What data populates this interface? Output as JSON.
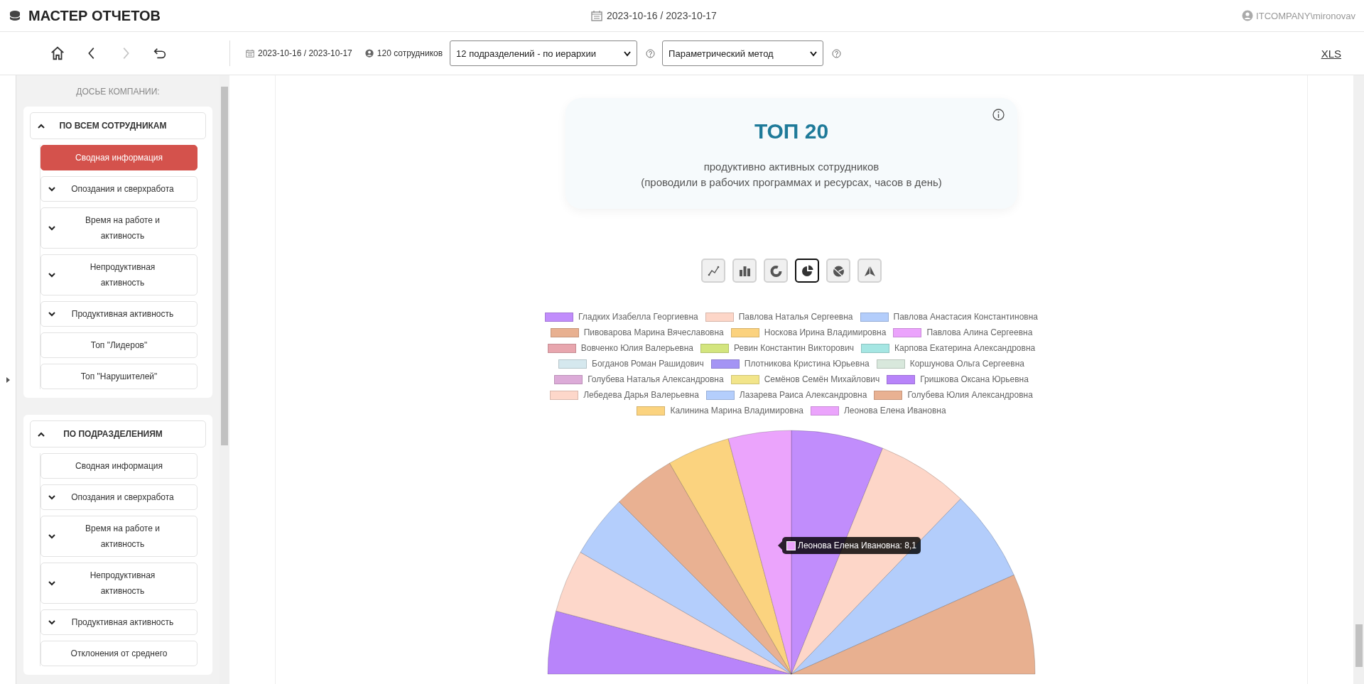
{
  "header": {
    "title": "МАСТЕР ОТЧЕТОВ",
    "period": "2023-10-16 / 2023-10-17",
    "user": "ITCOMPANY\\mironovav"
  },
  "toolbar": {
    "nav": [
      {
        "kind": "home",
        "disabled": false
      },
      {
        "kind": "back",
        "disabled": false
      },
      {
        "kind": "forward",
        "disabled": true
      },
      {
        "kind": "undo",
        "disabled": false
      }
    ],
    "period": "2023-10-16 / 2023-10-17",
    "employees": "120 сотрудников",
    "division_select": {
      "value": "12 подразделений - по иерархии"
    },
    "method_select": {
      "value": "Параметрический метод"
    },
    "export_link": "XLS"
  },
  "sidebar": {
    "title": "ДОСЬЕ КОМПАНИИ:",
    "sections": [
      {
        "title": "ПО ВСЕМ СОТРУДНИКАМ",
        "expanded": true,
        "items": [
          {
            "label": "Сводная информация",
            "kind": "link",
            "selected": true
          },
          {
            "label": "Опоздания и сверхработа",
            "kind": "group",
            "expanded": false,
            "selected": false
          },
          {
            "label": "Время на работе и активность",
            "kind": "group",
            "expanded": false,
            "selected": false
          },
          {
            "label": "Непродуктивная активность",
            "kind": "group",
            "expanded": false,
            "selected": false
          },
          {
            "label": "Продуктивная активность",
            "kind": "group",
            "expanded": false,
            "selected": false
          },
          {
            "label": "Топ \"Лидеров\"",
            "kind": "link",
            "selected": false
          },
          {
            "label": "Топ \"Нарушителей\"",
            "kind": "link",
            "selected": false
          }
        ]
      },
      {
        "title": "ПО ПОДРАЗДЕЛЕНИЯМ",
        "expanded": true,
        "items": [
          {
            "label": "Сводная информация",
            "kind": "link",
            "selected": false
          },
          {
            "label": "Опоздания и сверхработа",
            "kind": "group",
            "expanded": false,
            "selected": false
          },
          {
            "label": "Время на работе и активность",
            "kind": "group",
            "expanded": false,
            "selected": false
          },
          {
            "label": "Непродуктивная активность",
            "kind": "group",
            "expanded": false,
            "selected": false
          },
          {
            "label": "Продуктивная активность",
            "kind": "group",
            "expanded": false,
            "selected": false
          },
          {
            "label": "Отклонения от среднего",
            "kind": "link",
            "selected": false
          }
        ]
      }
    ]
  },
  "report": {
    "title": "ТОП 20",
    "subtitle": [
      "продуктивно активных сотрудников",
      "(проводили в рабочих программах и ресурсах, часов в день)"
    ],
    "chart_types": [
      {
        "kind": "line",
        "selected": false
      },
      {
        "kind": "bar",
        "selected": false
      },
      {
        "kind": "donut",
        "selected": false
      },
      {
        "kind": "pie",
        "selected": true
      },
      {
        "kind": "polar",
        "selected": false
      },
      {
        "kind": "radar",
        "selected": false
      }
    ],
    "legend": [
      {
        "name": "Гладких Изабелла Георгиевна",
        "color": "#c18dfc"
      },
      {
        "name": "Павлова Наталья Сергеевна",
        "color": "#fdd6c8"
      },
      {
        "name": "Павлова Анастасия Константиновна",
        "color": "#b3cdfb"
      },
      {
        "name": "Пивоварова Марина Вячеславовна",
        "color": "#e8b090"
      },
      {
        "name": "Носкова Ирина Владимировна",
        "color": "#fbd27e"
      },
      {
        "name": "Павлова Алина Сергеевна",
        "color": "#eba3fc"
      },
      {
        "name": "Вовченко Юлия Валерьевна",
        "color": "#e8a6ae"
      },
      {
        "name": "Ревин Константин Викторович",
        "color": "#d3e57e"
      },
      {
        "name": "Карпова Екатерина Александровна",
        "color": "#a5e6e3"
      },
      {
        "name": "Богданов Роман Рашидович",
        "color": "#d5e8ee"
      },
      {
        "name": "Плотникова Кристина Юрьевна",
        "color": "#a494f4"
      },
      {
        "name": "Коршунова Ольга Сергеевна",
        "color": "#d8e8dc"
      },
      {
        "name": "Голубева Наталья Александровна",
        "color": "#dcabd8"
      },
      {
        "name": "Семёнов Семён Михайлович",
        "color": "#f2e58a"
      },
      {
        "name": "Гришкова Оксана Юрьевна",
        "color": "#b884fa"
      },
      {
        "name": "Лебедева Дарья Валерьевна",
        "color": "#fdd7ca"
      },
      {
        "name": "Лазарева Раиса Александровна",
        "color": "#b4cefc"
      },
      {
        "name": "Голубева Юлия Александровна",
        "color": "#e9b192"
      },
      {
        "name": "Калинина Марина Владимировна",
        "color": "#fbd37f"
      },
      {
        "name": "Леонова Елена Ивановна",
        "color": "#eba4fc"
      }
    ],
    "tooltip": {
      "text": "Леонова Елена Ивановна: 8,1",
      "color": "#eba4fc"
    }
  }
}
